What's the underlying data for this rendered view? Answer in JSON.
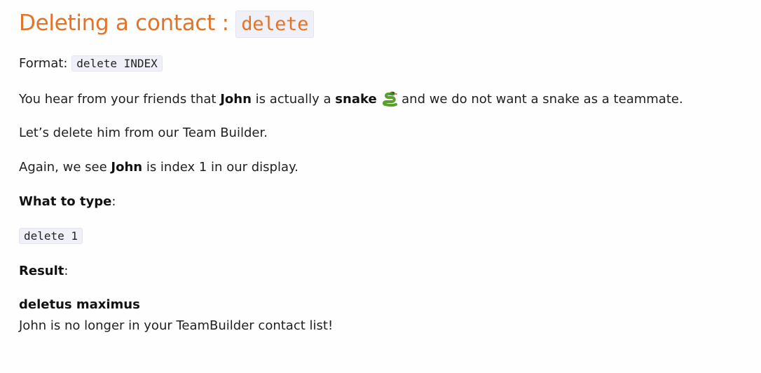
{
  "heading": {
    "text": "Deleting a contact : ",
    "command": "delete"
  },
  "format": {
    "label": "Format: ",
    "code": "delete INDEX"
  },
  "para1": {
    "prefix": "You hear from your friends that ",
    "name": "John",
    "middle": " is actually a ",
    "snake": "snake",
    "suffix": " and we do not want a snake as a teammate."
  },
  "para2": "Let’s delete him from our Team Builder.",
  "para3": {
    "prefix": "Again, we see ",
    "name": "John",
    "suffix": " is index 1 in our display."
  },
  "what_to_type": {
    "label": "What to type",
    "colon": ":"
  },
  "command_example": "delete 1",
  "result": {
    "label": "Result",
    "colon": ":"
  },
  "outcome": {
    "title": "deletus maximus",
    "message": "John is no longer in your TeamBuilder contact list!"
  },
  "icons": {
    "snake": "snake-icon"
  }
}
